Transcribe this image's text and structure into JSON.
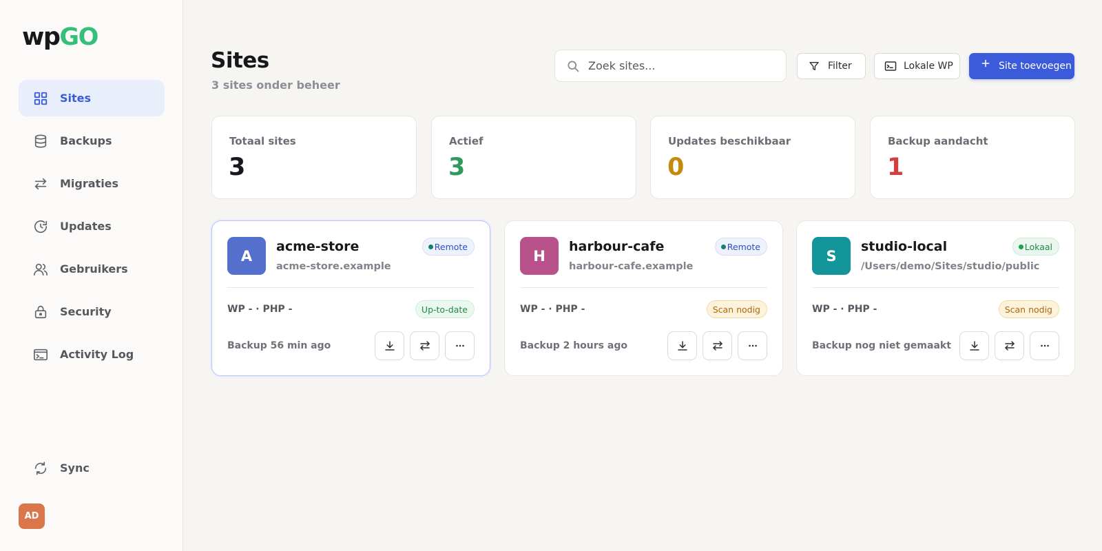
{
  "brand": {
    "logo_left": "wp",
    "logo_right": "GO",
    "accent": "#3b5bdb",
    "logo_green": "#35c07a"
  },
  "sidebar": {
    "items": [
      {
        "label": "Sites",
        "icon": "grid-icon",
        "active": true
      },
      {
        "label": "Backups",
        "icon": "database-icon"
      },
      {
        "label": "Migraties",
        "icon": "arrows-swap-icon"
      },
      {
        "label": "Updates",
        "icon": "clock-refresh-icon"
      },
      {
        "label": "Gebruikers",
        "icon": "users-icon"
      },
      {
        "label": "Security",
        "icon": "lock-icon"
      },
      {
        "label": "Activity Log",
        "icon": "terminal-icon"
      }
    ],
    "sync_label": "Sync",
    "avatar_initials": "AD"
  },
  "header": {
    "title": "Sites",
    "subtitle": "3 sites onder beheer",
    "search_placeholder": "Zoek sites...",
    "filter_label": "Filter",
    "local_label": "Lokale WP",
    "add_label": "Site toevoegen"
  },
  "stats": [
    {
      "label": "Totaal sites",
      "value": "3",
      "color": "#17181c"
    },
    {
      "label": "Actief",
      "value": "3",
      "color": "#2e9a5e"
    },
    {
      "label": "Updates beschikbaar",
      "value": "0",
      "color": "#c48a0c"
    },
    {
      "label": "Backup aandacht",
      "value": "1",
      "color": "#d13f3f"
    }
  ],
  "sites": [
    {
      "initial": "A",
      "name": "acme-store",
      "url": "acme-store.example",
      "type": "Remote",
      "versions": "WP - · PHP -",
      "status": "Up-to-date",
      "backup": "Backup 56 min ago",
      "color": "#5570cc"
    },
    {
      "initial": "H",
      "name": "harbour-cafe",
      "url": "harbour-cafe.example",
      "type": "Remote",
      "versions": "WP - · PHP -",
      "status": "Scan nodig",
      "backup": "Backup 2 hours ago",
      "color": "#b9528b"
    },
    {
      "initial": "S",
      "name": "studio-local",
      "url": "/Users/demo/Sites/studio/public",
      "type": "Lokaal",
      "versions": "WP - · PHP -",
      "status": "Scan nodig",
      "backup": "Backup nog niet gemaakt",
      "color": "#13939a"
    }
  ]
}
